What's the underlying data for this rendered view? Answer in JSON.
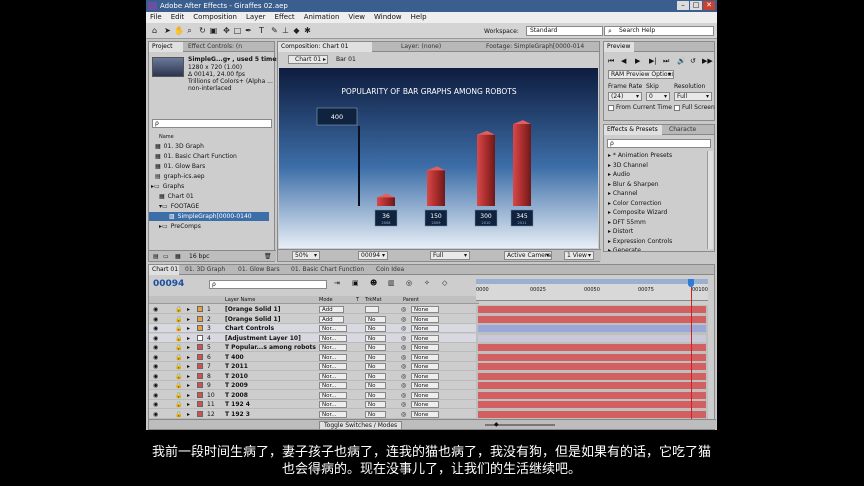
{
  "title": "Adobe After Effects - Giraffes 02.aep",
  "menu": [
    "File",
    "Edit",
    "Composition",
    "Layer",
    "Effect",
    "Animation",
    "View",
    "Window",
    "Help"
  ],
  "workspace": {
    "label": "Workspace:",
    "value": "Standard"
  },
  "search_help": "Search Help",
  "project_panel": {
    "tabs": [
      "Project",
      "Effect Controls: (n"
    ],
    "asset": {
      "name": "SimpleG...g▾ , used 5 times",
      "line1": "1280 x 720 (1.00)",
      "line2": "Δ 00141, 24.00 fps",
      "line3": "Trillions of Colors+ (Alpha ...",
      "line4": "non-interlaced"
    },
    "search_placeholder": "ρ",
    "col_name": "Name",
    "items": [
      "01. 3D Graph",
      "01. Basic Chart Function",
      "01. Glow Bars",
      "graph-ics.aep",
      "Graphs",
      "Chart 01",
      "FOOTAGE",
      "SimpleGraph[0000-0140",
      "PreComps"
    ],
    "bpc": "16 bpc"
  },
  "comp_panel": {
    "tabs": [
      "Composition: Chart 01",
      "Layer: (none)",
      "Footage: SimpleGraph[0000-014"
    ],
    "breadcrumbs": [
      "Chart 01",
      "Bar 01"
    ],
    "zoom": "50%",
    "timecode": "00094",
    "quality": "Full",
    "camera": "Active Camera",
    "view": "1 View"
  },
  "chart_data": {
    "type": "bar",
    "title": "POPULARITY OF BAR GRAPHS AMONG ROBOTS",
    "categories": [
      "2008",
      "2009",
      "2010",
      "2011"
    ],
    "values": [
      36,
      150,
      300,
      345
    ],
    "extra_label": {
      "value": "400"
    },
    "bar_color": "#b53a3a"
  },
  "preview_panel": {
    "tab": "Preview",
    "ram_options": "RAM Preview Options",
    "frame_rate_label": "Frame Rate",
    "skip_label": "Skip",
    "resolution_label": "Resolution",
    "frame_rate": "(24)",
    "skip": "0",
    "resolution": "Full",
    "from_current": "From Current Time",
    "full_screen": "Full Screen"
  },
  "effects_panel": {
    "tabs": [
      "Effects & Presets",
      "Characte"
    ],
    "search_placeholder": "ρ",
    "items": [
      "* Animation Presets",
      "3D Channel",
      "Audio",
      "Blur & Sharpen",
      "Channel",
      "Color Correction",
      "Composite Wizard",
      "DFT 55mm",
      "Distort",
      "Expression Controls",
      "Generate"
    ]
  },
  "timeline": {
    "tabs": [
      "Chart 01",
      "01. 3D Graph",
      "01. Glow Bars",
      "01. Basic Chart Function",
      "Coin Idea"
    ],
    "timecode": "00094",
    "search_placeholder": "ρ",
    "col_layer": "Layer Name",
    "col_mode": "Mode",
    "col_t": "T",
    "col_trkmat": "TrkMat",
    "col_parent": "Parent",
    "ruler": [
      "0000",
      "00025",
      "00050",
      "00075",
      "00100"
    ],
    "layers": [
      {
        "num": "1",
        "name": "[Orange Solid 1]",
        "mode": "Add",
        "trk": "",
        "parent": "None",
        "color": "#e8a040"
      },
      {
        "num": "2",
        "name": "[Orange Solid 1]",
        "mode": "Add",
        "trk": "No",
        "parent": "None",
        "color": "#e8a040"
      },
      {
        "num": "3",
        "name": "Chart Controls",
        "mode": "Nor...",
        "trk": "No",
        "parent": "None",
        "color": "#e8a040"
      },
      {
        "num": "4",
        "name": "[Adjustment Layer 10]",
        "mode": "Nor...",
        "trk": "No",
        "parent": "None",
        "color": "#ffffff"
      },
      {
        "num": "5",
        "name": "T  Popular...s among robots",
        "mode": "Nor...",
        "trk": "No",
        "parent": "None",
        "color": "#d05050"
      },
      {
        "num": "6",
        "name": "T  400",
        "mode": "Nor...",
        "trk": "No",
        "parent": "None",
        "color": "#d05050"
      },
      {
        "num": "7",
        "name": "T  2011",
        "mode": "Nor...",
        "trk": "No",
        "parent": "None",
        "color": "#d05050"
      },
      {
        "num": "8",
        "name": "T  2010",
        "mode": "Nor...",
        "trk": "No",
        "parent": "None",
        "color": "#d05050"
      },
      {
        "num": "9",
        "name": "T  2009",
        "mode": "Nor...",
        "trk": "No",
        "parent": "None",
        "color": "#d05050"
      },
      {
        "num": "10",
        "name": "T  2008",
        "mode": "Nor...",
        "trk": "No",
        "parent": "None",
        "color": "#d05050"
      },
      {
        "num": "11",
        "name": "T  192 4",
        "mode": "Nor...",
        "trk": "No",
        "parent": "None",
        "color": "#d05050"
      },
      {
        "num": "12",
        "name": "T  192 3",
        "mode": "Nor...",
        "trk": "No",
        "parent": "None",
        "color": "#d05050"
      }
    ],
    "toggle": "Toggle Switches / Modes"
  },
  "subtitle": "我前一段时间生病了，妻子孩子也病了，连我的猫也病了，我没有狗，但是如果有的话，它吃了猫也会得病的。现在没事儿了，让我们的生活继续吧。"
}
